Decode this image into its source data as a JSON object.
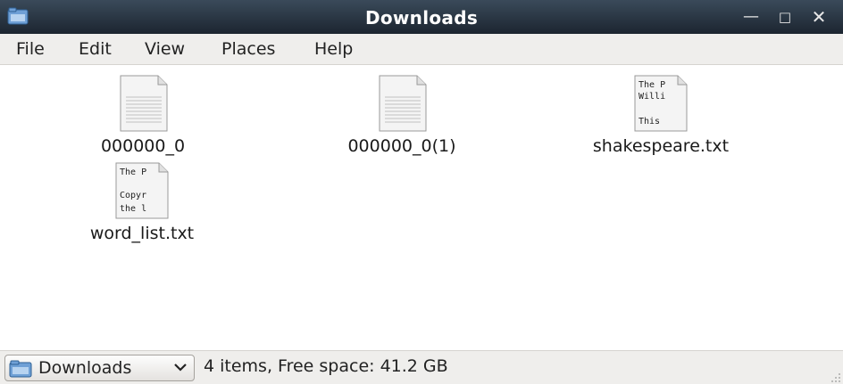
{
  "window": {
    "title": "Downloads"
  },
  "menu": [
    "File",
    "Edit",
    "View",
    "Places",
    "Help"
  ],
  "files": [
    {
      "name": "000000_0",
      "kind": "blank"
    },
    {
      "name": "000000_0(1)",
      "kind": "blank"
    },
    {
      "name": "shakespeare.txt",
      "kind": "text",
      "preview": [
        "The P",
        "Willi",
        "",
        "This"
      ]
    },
    {
      "name": "word_list.txt",
      "kind": "text",
      "preview": [
        "The P",
        "",
        "Copyr",
        "the l"
      ]
    }
  ],
  "statusbar": {
    "location": "Downloads",
    "summary": "4 items, Free space: 41.2 GB"
  }
}
